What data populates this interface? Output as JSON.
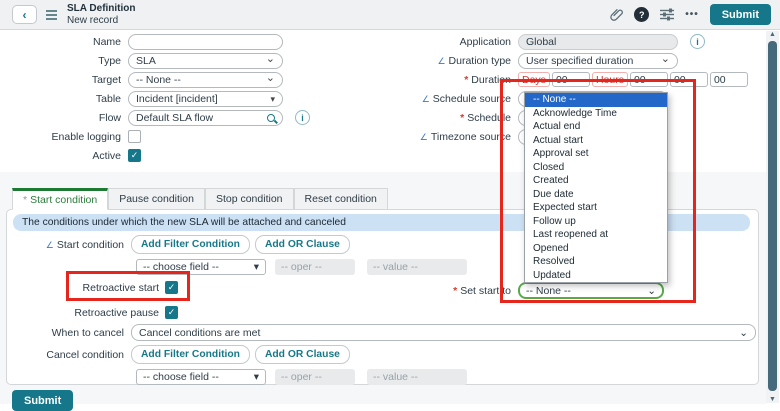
{
  "header": {
    "title": "SLA Definition",
    "subtitle": "New record",
    "submit_label": "Submit"
  },
  "icons": {
    "back": "‹",
    "check": "✓",
    "chevron_down": "⌄",
    "ref_triangle": "▾",
    "field_indicator": "∠",
    "info": "i",
    "help": "?",
    "more": "•••",
    "scroll_up": "▲",
    "scroll_down": "▼",
    "required": "*"
  },
  "form": {
    "name": {
      "label": "Name",
      "value": ""
    },
    "type": {
      "label": "Type",
      "value": "SLA"
    },
    "target": {
      "label": "Target",
      "value": "-- None --"
    },
    "table": {
      "label": "Table",
      "value": "Incident [incident]"
    },
    "flow": {
      "label": "Flow",
      "value": "Default SLA flow"
    },
    "enable_logging": {
      "label": "Enable logging",
      "checked": false
    },
    "active": {
      "label": "Active",
      "checked": true
    },
    "application": {
      "label": "Application",
      "value": "Global"
    },
    "duration_type": {
      "label": "Duration type",
      "value": "User specified duration"
    },
    "duration": {
      "label": "Duration",
      "days_label": "Days",
      "days": "00",
      "hours_label": "Hours",
      "hours": "00",
      "minutes": "00",
      "seconds": "00"
    },
    "schedule_source": {
      "label": "Schedule source"
    },
    "schedule": {
      "label": "Schedule"
    },
    "timezone_source": {
      "label": "Timezone source"
    },
    "set_start_to": {
      "label": "Set start to",
      "value": "-- None --"
    }
  },
  "dropdown": {
    "selected": "-- None --",
    "options": [
      "-- None --",
      "Acknowledge Time",
      "Actual end",
      "Actual start",
      "Approval set",
      "Closed",
      "Created",
      "Due date",
      "Expected start",
      "Follow up",
      "Last reopened at",
      "Opened",
      "Resolved",
      "Updated"
    ]
  },
  "tabs": [
    {
      "label": "Start condition",
      "asterisk": "*",
      "active": true
    },
    {
      "label": "Pause condition",
      "active": false
    },
    {
      "label": "Stop condition",
      "active": false
    },
    {
      "label": "Reset condition",
      "active": false
    }
  ],
  "conditions": {
    "info": "The conditions under which the new SLA will be attached and canceled",
    "start_condition_label": "Start condition",
    "add_filter_label": "Add Filter Condition",
    "add_or_label": "Add OR Clause",
    "choose_field": "-- choose field --",
    "oper": "-- oper --",
    "value": "-- value --",
    "retroactive_start": {
      "label": "Retroactive start",
      "checked": true
    },
    "retroactive_pause": {
      "label": "Retroactive pause",
      "checked": true
    },
    "when_to_cancel": {
      "label": "When to cancel",
      "value": "Cancel conditions are met"
    },
    "cancel_condition_label": "Cancel condition"
  },
  "footer": {
    "submit_label": "Submit"
  },
  "colors": {
    "accent": "#157789",
    "annotation": "#e6251d",
    "dropdown_highlight": "#2368c8",
    "tab_green": "#2b7d3c",
    "info_bg": "#cde1f4"
  }
}
